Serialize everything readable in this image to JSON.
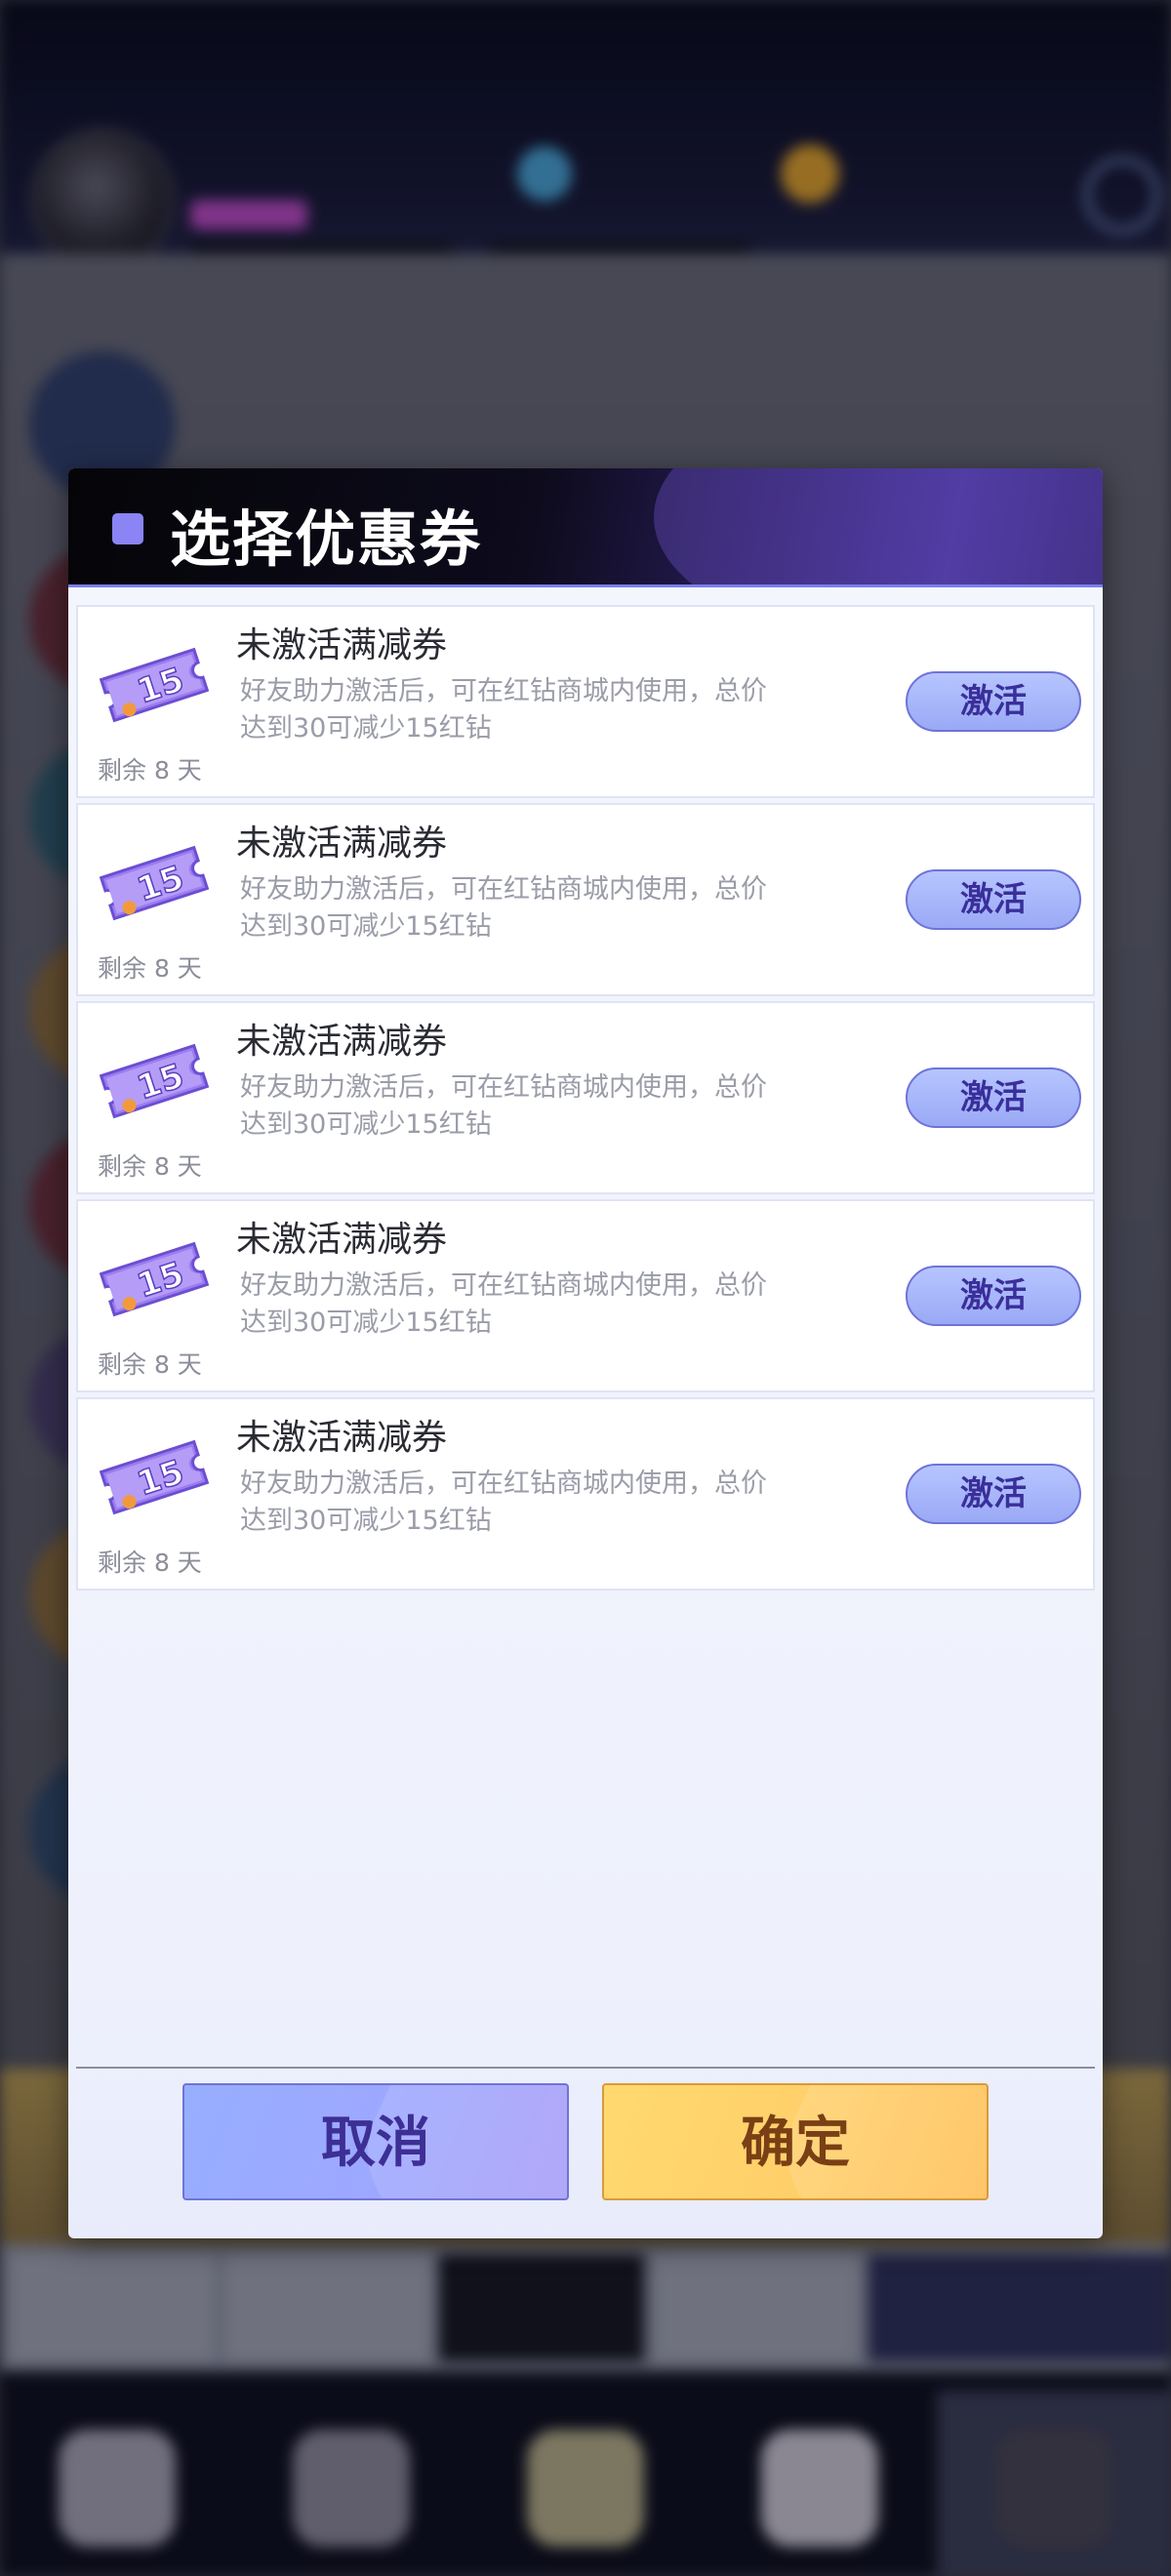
{
  "dialog": {
    "title": "选择优惠券",
    "coupons": [
      {
        "title": "未激活满减券",
        "description": "好友助力激活后，可在红钻商城内使用，总价达到30可减少15红钻",
        "remaining": "剩余 8 天",
        "ticket_value": "15",
        "action_label": "激活"
      },
      {
        "title": "未激活满减券",
        "description": "好友助力激活后，可在红钻商城内使用，总价达到30可减少15红钻",
        "remaining": "剩余 8 天",
        "ticket_value": "15",
        "action_label": "激活"
      },
      {
        "title": "未激活满减券",
        "description": "好友助力激活后，可在红钻商城内使用，总价达到30可减少15红钻",
        "remaining": "剩余 8 天",
        "ticket_value": "15",
        "action_label": "激活"
      },
      {
        "title": "未激活满减券",
        "description": "好友助力激活后，可在红钻商城内使用，总价达到30可减少15红钻",
        "remaining": "剩余 8 天",
        "ticket_value": "15",
        "action_label": "激活"
      },
      {
        "title": "未激活满减券",
        "description": "好友助力激活后，可在红钻商城内使用，总价达到30可减少15红钻",
        "remaining": "剩余 8 天",
        "ticket_value": "15",
        "action_label": "激活"
      }
    ],
    "cancel_label": "取消",
    "confirm_label": "确定"
  },
  "icons": {
    "ticket": "coupon-ticket-icon",
    "title_marker": "square-marker-icon"
  },
  "colors": {
    "accent": "#8a84f5",
    "activate_button": "#a9b7fb",
    "cancel_button": "#9da8ff",
    "confirm_button": "#ffd06a"
  }
}
